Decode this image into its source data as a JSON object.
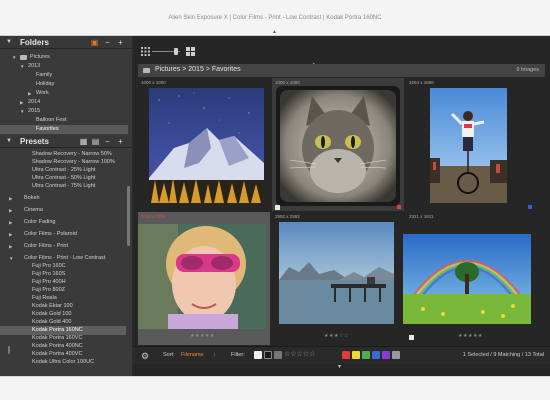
{
  "window": {
    "title": "Alien Skin Exposure X | Color Films - Print - Low Contrast | Kodak Portra 160NC"
  },
  "sidebar": {
    "folders": {
      "label": "Folders",
      "tree": [
        {
          "label": "Pictures",
          "indent": 0,
          "expanded": true,
          "folder": true
        },
        {
          "label": "2013",
          "indent": 1,
          "expanded": true,
          "folder": false
        },
        {
          "label": "Family",
          "indent": 2,
          "expanded": null,
          "folder": false
        },
        {
          "label": "Holiday",
          "indent": 2,
          "expanded": null,
          "folder": false
        },
        {
          "label": "Work",
          "indent": 2,
          "expanded": false,
          "folder": false
        },
        {
          "label": "2014",
          "indent": 1,
          "expanded": false,
          "folder": false
        },
        {
          "label": "2015",
          "indent": 1,
          "expanded": true,
          "folder": false
        },
        {
          "label": "Balloon Fest",
          "indent": 2,
          "expanded": null,
          "folder": false
        },
        {
          "label": "Favorites",
          "indent": 2,
          "expanded": null,
          "folder": false,
          "selected": true
        }
      ]
    },
    "presets": {
      "label": "Presets",
      "items": [
        {
          "label": "Shadow Recovery - Narrow 50%",
          "type": "item"
        },
        {
          "label": "Shadow Recovery - Narrow 100%",
          "type": "item"
        },
        {
          "label": "Ultra Contrast - 25% Light",
          "type": "item"
        },
        {
          "label": "Ultra Contrast - 50% Light",
          "type": "item"
        },
        {
          "label": "Ultra Contrast - 75% Light",
          "type": "item"
        },
        {
          "label": "",
          "type": "gap"
        },
        {
          "label": "Bokeh",
          "type": "cat",
          "expanded": false
        },
        {
          "label": "",
          "type": "gap"
        },
        {
          "label": "Cinema",
          "type": "cat",
          "expanded": false
        },
        {
          "label": "",
          "type": "gap"
        },
        {
          "label": "Color Fading",
          "type": "cat",
          "expanded": false
        },
        {
          "label": "",
          "type": "gap"
        },
        {
          "label": "Color Films - Polaroid",
          "type": "cat",
          "expanded": false
        },
        {
          "label": "",
          "type": "gap"
        },
        {
          "label": "Color Films - Print",
          "type": "cat",
          "expanded": false
        },
        {
          "label": "",
          "type": "gap"
        },
        {
          "label": "Color Films - Print - Low Contrast",
          "type": "cat",
          "expanded": true
        },
        {
          "label": "Fuji Pro 160C",
          "type": "item"
        },
        {
          "label": "Fuji Pro 160S",
          "type": "item"
        },
        {
          "label": "Fuji Pro 400H",
          "type": "item"
        },
        {
          "label": "Fuji Pro 800Z",
          "type": "item"
        },
        {
          "label": "Fuji Reala",
          "type": "item"
        },
        {
          "label": "Kodak Ektar 100",
          "type": "item"
        },
        {
          "label": "Kodak Gold 100",
          "type": "item"
        },
        {
          "label": "Kodak Gold 400",
          "type": "item"
        },
        {
          "label": "Kodak Portra 160NC",
          "type": "item",
          "selected": true
        },
        {
          "label": "Kodak Portra 160VC",
          "type": "item"
        },
        {
          "label": "Kodak Portra 400NC",
          "type": "item"
        },
        {
          "label": "Kodak Portra 400VC",
          "type": "item"
        },
        {
          "label": "Kodak Ultra Color 100UC",
          "type": "item"
        }
      ]
    }
  },
  "main": {
    "breadcrumb": "Pictures > 2015 > Favorites",
    "image_count": "9 Images",
    "thumbnails": [
      {
        "dims": "1000 x 1000",
        "subject": "mountain",
        "stars": "",
        "flag": "",
        "color_label": ""
      },
      {
        "dims": "1000 x 1000",
        "subject": "cat",
        "stars": "",
        "flag": "white",
        "color_label": "red"
      },
      {
        "dims": "3264 x 4896",
        "subject": "unicyclist",
        "stars": "",
        "flag": "",
        "color_label": "blue"
      },
      {
        "dims": "1048 x 1536",
        "subject": "girl",
        "stars": "★★★★★",
        "flag": "",
        "color_label": ""
      },
      {
        "dims": "2992 x 2992",
        "subject": "pier",
        "stars": "★★★☆☆",
        "flag": "",
        "color_label": ""
      },
      {
        "dims": "2321 x 1611",
        "subject": "rainbow",
        "stars": "★★★★★",
        "flag": "white",
        "color_label": ""
      }
    ]
  },
  "bottombar": {
    "sort_label": "Sort:",
    "sort_value": "Filename",
    "filter_label": "Filter:",
    "status": "1 Selected / 9 Matching / 13 Total",
    "filter_stars": "☆☆☆☆☆",
    "filter_colors": [
      "#e03a3a",
      "#f0d832",
      "#4caf50",
      "#3a6ad8",
      "#8a3ad8",
      "#9a9a9a"
    ]
  }
}
